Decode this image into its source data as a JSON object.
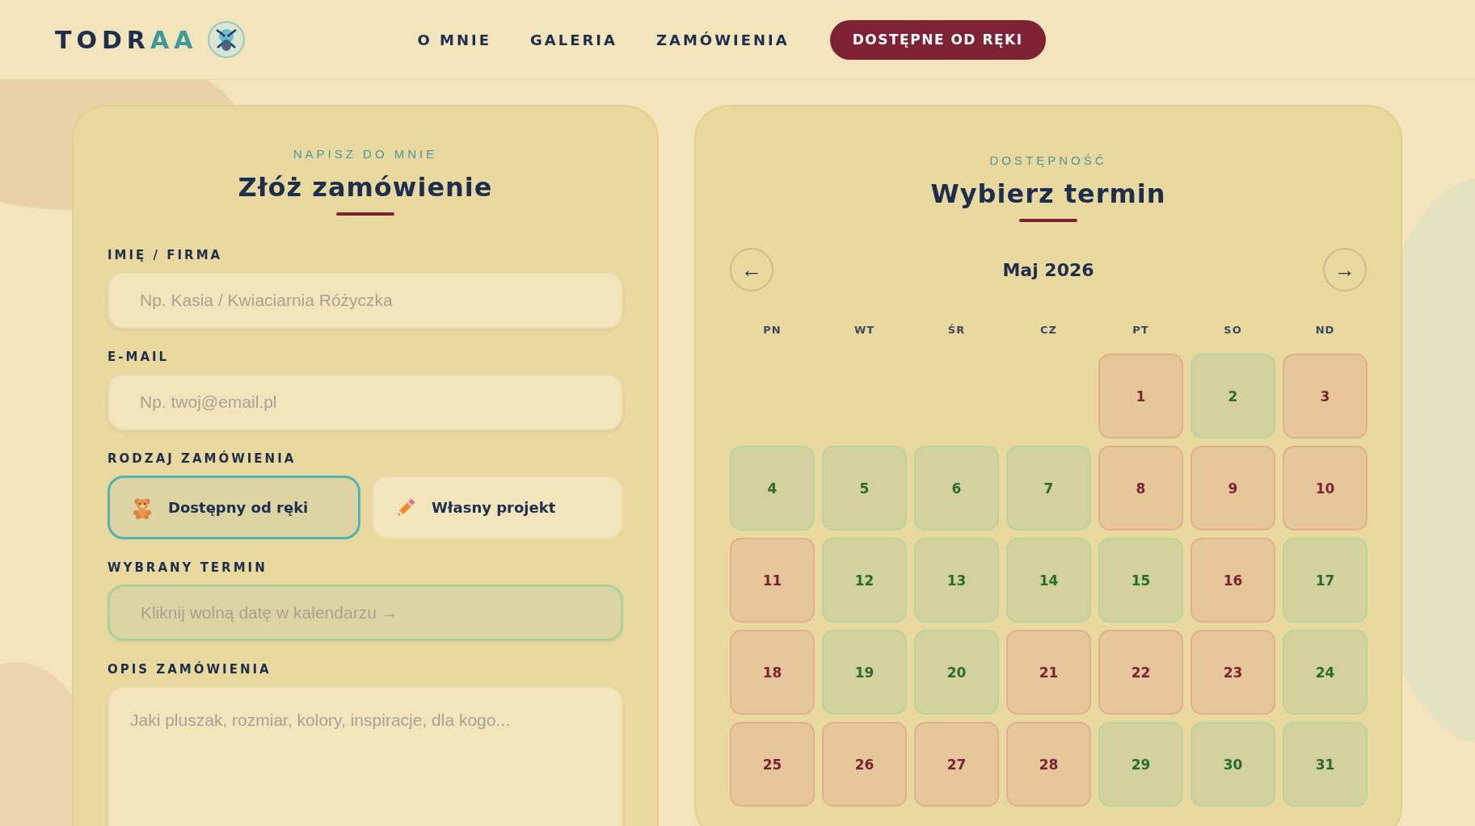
{
  "header": {
    "logo": [
      {
        "text": "TODR",
        "accent": false
      },
      {
        "text": "AA",
        "accent": true
      }
    ],
    "nav": [
      {
        "label": "O MNIE"
      },
      {
        "label": "GALERIA"
      },
      {
        "label": "ZAMÓWIENIA"
      }
    ],
    "cta": "DOSTĘPNE OD RĘKI"
  },
  "order_form": {
    "eyebrow": "NAPISZ DO MNIE",
    "title": "Złóż zamówienie",
    "fields": [
      {
        "kind": "text",
        "label": "IMIĘ / FIRMA",
        "placeholder": "Np. Kasia / Kwiaciarnia Różyczka"
      },
      {
        "kind": "text",
        "label": "E-MAIL",
        "placeholder": "Np. twoj@email.pl"
      },
      {
        "kind": "choice",
        "label": "RODZAJ ZAMÓWIENIA",
        "options": [
          {
            "label": "Dostępny od ręki",
            "selected": true
          },
          {
            "label": "Własny projekt",
            "selected": false
          }
        ]
      },
      {
        "kind": "date",
        "label": "WYBRANY TERMIN",
        "placeholder": "Kliknij wolną datę w kalendarzu →"
      },
      {
        "kind": "textarea",
        "label": "OPIS ZAMÓWIENIA",
        "placeholder": "Jaki pluszak, rozmiar, kolory, inspiracje, dla kogo..."
      }
    ]
  },
  "calendar": {
    "eyebrow": "DOSTĘPNOŚĆ",
    "title": "Wybierz termin",
    "prev": "←",
    "next": "→",
    "month": "Maj 2026",
    "weekdays": [
      "PN",
      "WT",
      "ŚR",
      "CZ",
      "PT",
      "SO",
      "ND"
    ],
    "weeks": [
      [
        {
          "day": "1",
          "available": false
        },
        {
          "day": "2",
          "available": true
        },
        {
          "day": "3",
          "available": false
        }
      ],
      [
        {
          "day": "4",
          "available": true
        },
        {
          "day": "5",
          "available": true
        },
        {
          "day": "6",
          "available": true
        },
        {
          "day": "7",
          "available": true
        },
        {
          "day": "8",
          "available": false
        },
        {
          "day": "9",
          "available": false
        },
        {
          "day": "10",
          "available": false
        }
      ],
      [
        {
          "day": "11",
          "available": false
        },
        {
          "day": "12",
          "available": true
        },
        {
          "day": "13",
          "available": true
        },
        {
          "day": "14",
          "available": true
        },
        {
          "day": "15",
          "available": true
        },
        {
          "day": "16",
          "available": false
        },
        {
          "day": "17",
          "available": true
        }
      ],
      [
        {
          "day": "18",
          "available": false
        },
        {
          "day": "19",
          "available": true
        },
        {
          "day": "20",
          "available": true
        },
        {
          "day": "21",
          "available": false
        },
        {
          "day": "22",
          "available": false
        },
        {
          "day": "23",
          "available": false
        },
        {
          "day": "24",
          "available": true
        }
      ],
      [
        {
          "day": "25",
          "available": false
        },
        {
          "day": "26",
          "available": false
        },
        {
          "day": "27",
          "available": false
        },
        {
          "day": "28",
          "available": false
        },
        {
          "day": "29",
          "available": true
        },
        {
          "day": "30",
          "available": true
        },
        {
          "day": "31",
          "available": true
        }
      ]
    ]
  }
}
